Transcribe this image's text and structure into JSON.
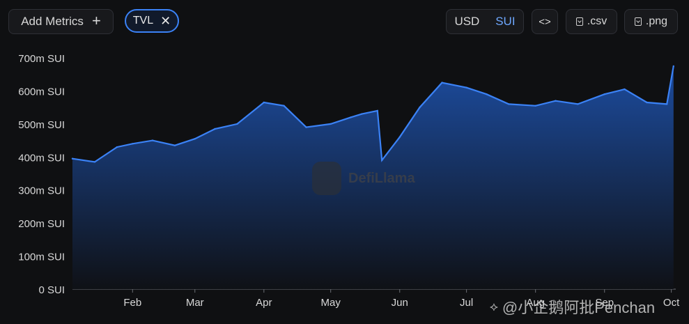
{
  "toolbar": {
    "add_metrics_label": "Add Metrics",
    "add_metrics_icon": "plus-icon",
    "metric_chip_label": "TVL",
    "metric_chip_icon": "close-icon",
    "currency_options": [
      "USD",
      "SUI"
    ],
    "currency_selected": "SUI",
    "embed_label": "<>",
    "csv_label": ".csv",
    "png_label": ".png",
    "download_icon": "download-icon"
  },
  "watermark": {
    "brand": "DefiLlama",
    "overlay_text": "@小企鹅阿批Penchan"
  },
  "colors": {
    "background": "#0f1012",
    "line": "#3b82f6",
    "area_top": "#1d4fa6",
    "area_bottom": "#0f1116",
    "accent": "#6ea8ff"
  },
  "chart_data": {
    "type": "area",
    "series": [
      {
        "name": "TVL",
        "x": [
          "Jan 05",
          "Jan 15",
          "Jan 25",
          "Feb 01",
          "Feb 10",
          "Feb 20",
          "Mar 01",
          "Mar 10",
          "Mar 20",
          "Apr 01",
          "Apr 10",
          "Apr 20",
          "May 01",
          "May 10",
          "May 15",
          "May 22",
          "May 24",
          "Jun 01",
          "Jun 10",
          "Jun 20",
          "Jul 01",
          "Jul 10",
          "Jul 20",
          "Aug 01",
          "Aug 10",
          "Aug 20",
          "Sep 01",
          "Sep 10",
          "Sep 20",
          "Sep 29",
          "Oct 02"
        ],
        "values": [
          395,
          385,
          430,
          440,
          450,
          435,
          455,
          485,
          500,
          565,
          555,
          490,
          500,
          520,
          530,
          540,
          390,
          460,
          550,
          625,
          610,
          590,
          560,
          555,
          570,
          560,
          590,
          605,
          565,
          560,
          675
        ]
      }
    ],
    "y_ticks": [
      "0 SUI",
      "100m SUI",
      "200m SUI",
      "300m SUI",
      "400m SUI",
      "500m SUI",
      "600m SUI",
      "700m SUI"
    ],
    "x_ticks": [
      "Feb",
      "Mar",
      "Apr",
      "May",
      "Jun",
      "Jul",
      "Aug",
      "Sep",
      "Oct"
    ],
    "ylim": [
      0,
      700
    ],
    "unit": "m SUI",
    "grid": false,
    "legend": "none"
  }
}
